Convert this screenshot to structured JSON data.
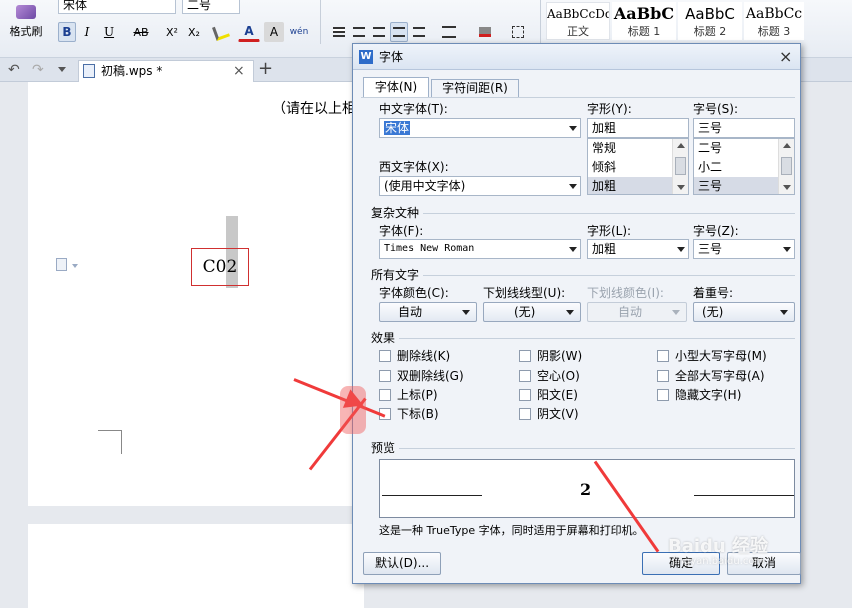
{
  "toolbar": {
    "format_painter": "格式刷",
    "font_name": "宋体",
    "font_size": "二号",
    "bold": "B",
    "italic": "I",
    "underline": "U",
    "strike": "AB",
    "superscript": "X²",
    "subscript": "X₂",
    "font_color": "A",
    "char_shade": "A",
    "phonetic": "wén",
    "styles": [
      {
        "preview": "AaBbCcDd",
        "label": "正文"
      },
      {
        "preview": "AaBbC",
        "label": "标题 1"
      },
      {
        "preview": "AaBbC",
        "label": "标题 2"
      },
      {
        "preview": "AaBbCc",
        "label": "标题 3"
      }
    ]
  },
  "tabbar": {
    "doc_tab": "初稿.wps *",
    "close": "×",
    "add": "+"
  },
  "document": {
    "hint_text": "（请在以上相",
    "selected_text": "C02"
  },
  "dialog": {
    "title": "字体",
    "close": "×",
    "tabs": [
      "字体(N)",
      "字符间距(R)"
    ],
    "chinese_font": {
      "label": "中文字体(T):",
      "value": "宋体"
    },
    "style": {
      "label": "字形(Y):",
      "value": "加粗",
      "options": [
        "常规",
        "倾斜",
        "加粗"
      ]
    },
    "size": {
      "label": "字号(S):",
      "value": "三号",
      "options": [
        "二号",
        "小二",
        "三号"
      ]
    },
    "western_font": {
      "label": "西文字体(X):",
      "value": "(使用中文字体)"
    },
    "complex_script": {
      "group": "复杂文种",
      "font_label": "字体(F):",
      "font_value": "Times New Roman",
      "style_label": "字形(L):",
      "style_value": "加粗",
      "size_label": "字号(Z):",
      "size_value": "三号"
    },
    "all_text": {
      "group": "所有文字",
      "font_color_label": "字体颜色(C):",
      "font_color_value": "自动",
      "underline_type_label": "下划线线型(U):",
      "underline_type_value": "(无)",
      "underline_color_label": "下划线颜色(I):",
      "underline_color_value": "自动",
      "emphasis_label": "着重号:",
      "emphasis_value": "(无)"
    },
    "effects": {
      "group": "效果",
      "items": [
        "删除线(K)",
        "双删除线(G)",
        "上标(P)",
        "下标(B)",
        "阴影(W)",
        "空心(O)",
        "阳文(E)",
        "阴文(V)",
        "小型大写字母(M)",
        "全部大写字母(A)",
        "隐藏文字(H)"
      ]
    },
    "preview": {
      "group": "预览",
      "text": "2"
    },
    "note": "这是一种 TrueType 字体，同时适用于屏幕和打印机。",
    "default_button": "默认(D)...",
    "ok_button": "确定",
    "cancel_button": "取消"
  },
  "watermark": "Baidu 经验",
  "watermark_url": "jingyan.baidu.com",
  "colors": {
    "accent": "#3a6fb4",
    "annotation_arrow": "#f03a3a",
    "selection_bar": "#c8c8c8",
    "text_box_border": "#d03030"
  }
}
